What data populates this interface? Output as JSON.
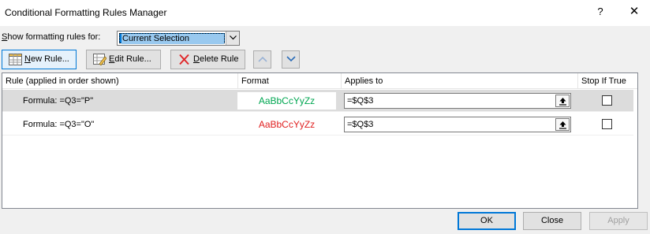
{
  "window": {
    "title": "Conditional Formatting Rules Manager",
    "help_glyph": "?",
    "close_glyph": "✕"
  },
  "show_rules": {
    "label_prefix": "",
    "label_accel": "S",
    "label_rest": "how formatting rules for:",
    "selected": "Current Selection"
  },
  "toolbar": {
    "new_rule": {
      "accel": "N",
      "rest": "ew Rule..."
    },
    "edit_rule": {
      "accel": "E",
      "rest": "dit Rule..."
    },
    "delete_rule": {
      "accel": "D",
      "rest": "elete Rule"
    }
  },
  "grid": {
    "headers": {
      "rule": "Rule (applied in order shown)",
      "format": "Format",
      "applies_to": "Applies to",
      "stop_if_true": "Stop If True"
    },
    "rows": [
      {
        "rule": "Formula: =Q3=\"P\"",
        "format_preview": "AaBbCcYyZz",
        "format_color": "#00a651",
        "applies_to": "=$Q$3",
        "stop_if_true": false
      },
      {
        "rule": "Formula: =Q3=\"O\"",
        "format_preview": "AaBbCcYyZz",
        "format_color": "#e02020",
        "applies_to": "=$Q$3",
        "stop_if_true": false
      }
    ]
  },
  "footer": {
    "ok": "OK",
    "close": "Close",
    "apply": "Apply"
  },
  "colors": {
    "accent": "#0078d7",
    "selection_bg": "#dcdcdc"
  }
}
